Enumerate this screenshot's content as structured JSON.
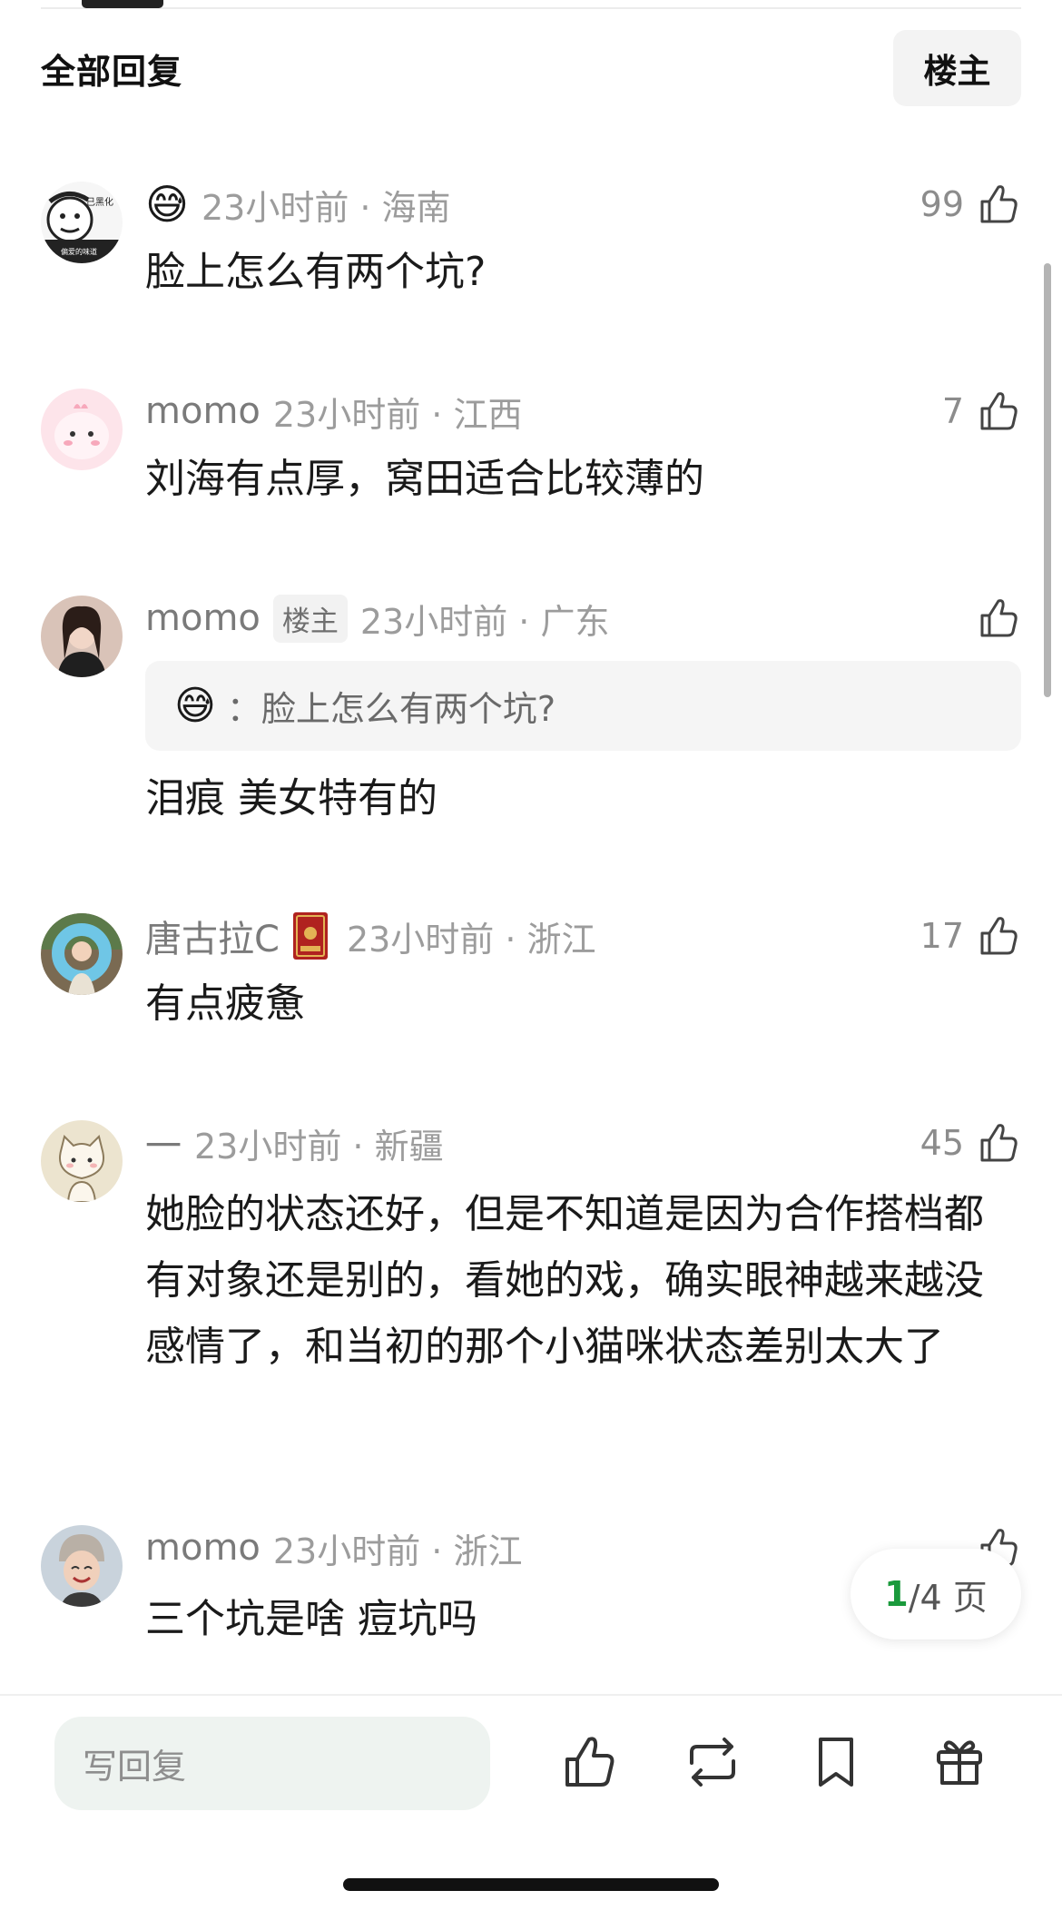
{
  "header": {
    "title": "全部回复",
    "op_filter": "楼主"
  },
  "comments": [
    {
      "username": "",
      "meta": "23小时前 · 海南",
      "likes": "99",
      "text": "脸上怎么有两个坑?",
      "avatar": "meme-face-avatar",
      "avatar_text_1": "已黑化",
      "avatar_text_2": "偏爱的味道"
    },
    {
      "username": "momo",
      "meta": "23小时前 · 江西",
      "likes": "7",
      "text": "刘海有点厚，窝田适合比较薄的",
      "avatar": "pink-cartoon-avatar"
    },
    {
      "username": "momo",
      "badge": "楼主",
      "meta": "23小时前 · 广东",
      "likes": "",
      "quote": "脸上怎么有两个坑?",
      "text": "泪痕 美女特有的",
      "avatar": "girl-photo-avatar"
    },
    {
      "username": "唐古拉C",
      "meta": "23小时前 · 浙江",
      "likes": "17",
      "text": "有点疲惫",
      "avatar": "swim-ring-avatar"
    },
    {
      "username": "一",
      "meta": "23小时前 · 新疆",
      "likes": "45",
      "text": "她脸的状态还好，但是不知道是因为合作搭档都有对象还是别的，看她的戏，确实眼神越来越没感情了，和当初的那个小猫咪状态差别太大了",
      "avatar": "cat-cartoon-avatar"
    },
    {
      "username": "momo",
      "meta": "23小时前 · 浙江",
      "likes": "",
      "text": "三个坑是啥 痘坑吗",
      "avatar": "child-photo-avatar"
    }
  ],
  "pagination": {
    "current": "1",
    "total": "/4 页"
  },
  "bottom_bar": {
    "reply_placeholder": "写回复",
    "icons": [
      "like-icon",
      "repost-icon",
      "bookmark-icon",
      "gift-icon"
    ]
  },
  "colors": {
    "accent_green": "#1a9a3c",
    "meta_gray": "#9c9c9c"
  }
}
